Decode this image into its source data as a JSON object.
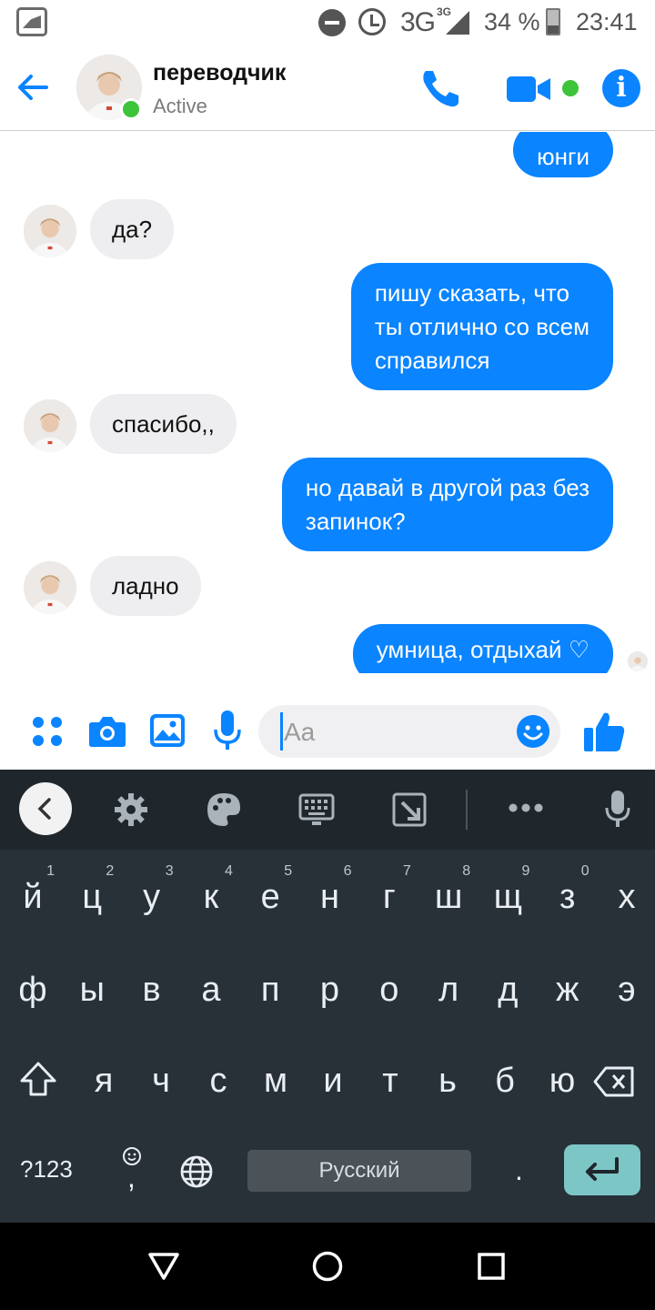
{
  "status_bar": {
    "network": "3G",
    "network_sup": "3G",
    "battery": "34 %",
    "time": "23:41",
    "icons": [
      "gallery-icon",
      "do-not-disturb-icon",
      "alarm-icon",
      "signal-icon",
      "battery-icon"
    ]
  },
  "header": {
    "name": "переводчик",
    "status": "Active",
    "icons": [
      "back-arrow-icon",
      "phone-icon",
      "video-camera-icon",
      "info-icon"
    ],
    "accent": "#0a84ff",
    "active_color": "#3dc43a"
  },
  "messages": [
    {
      "from": "me",
      "text": "юнги"
    },
    {
      "from": "them",
      "text": "да?"
    },
    {
      "from": "me",
      "lines": [
        "пишу сказать, что",
        "ты отлично со всем",
        "справился"
      ]
    },
    {
      "from": "them",
      "text": "спасибо,,"
    },
    {
      "from": "me",
      "lines": [
        "но давай в другой раз без",
        "запинок?"
      ]
    },
    {
      "from": "them",
      "text": "ладно"
    },
    {
      "from": "me",
      "text": "умница, отдыхай ♡"
    }
  ],
  "composer": {
    "placeholder": "Aa",
    "icons": [
      "apps-grid-icon",
      "camera-icon",
      "gallery-image-icon",
      "microphone-icon",
      "emoji-icon",
      "thumbs-up-icon"
    ]
  },
  "keyboard": {
    "toolbar_icons": [
      "back-chevron-icon",
      "settings-gear-icon",
      "palette-icon",
      "keyboard-icon",
      "resize-icon",
      "more-dots-icon",
      "microphone-icon"
    ],
    "row1": [
      {
        "key": "й",
        "num": "1"
      },
      {
        "key": "ц",
        "num": "2"
      },
      {
        "key": "у",
        "num": "3"
      },
      {
        "key": "к",
        "num": "4"
      },
      {
        "key": "е",
        "num": "5"
      },
      {
        "key": "н",
        "num": "6"
      },
      {
        "key": "г",
        "num": "7"
      },
      {
        "key": "ш",
        "num": "8"
      },
      {
        "key": "щ",
        "num": "9"
      },
      {
        "key": "з",
        "num": "0"
      },
      {
        "key": "х",
        "num": ""
      }
    ],
    "row2": [
      "ф",
      "ы",
      "в",
      "а",
      "п",
      "р",
      "о",
      "л",
      "д",
      "ж",
      "э"
    ],
    "row3": [
      "я",
      "ч",
      "с",
      "м",
      "и",
      "т",
      "ь",
      "б",
      "ю"
    ],
    "symbols_key": "?123",
    "comma_key": ",",
    "space_label": "Русский",
    "period_key": ".",
    "enter_color": "#7dc6c6"
  },
  "navbar": {
    "icons": [
      "nav-back-triangle-icon",
      "nav-home-circle-icon",
      "nav-recents-square-icon"
    ]
  }
}
